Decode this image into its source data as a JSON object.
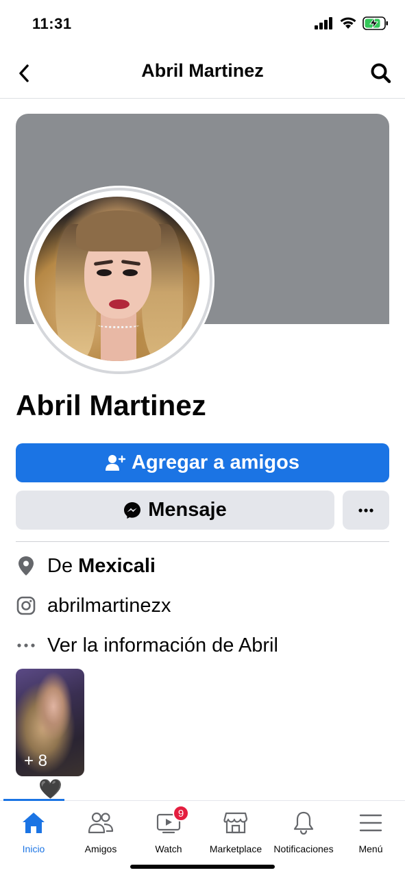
{
  "status_bar": {
    "time": "11:31",
    "icons": [
      "signal-icon",
      "wifi-icon",
      "battery-charging-icon"
    ],
    "battery_color": "#34c759"
  },
  "header": {
    "title": "Abril Martinez",
    "back_icon": "chevron-left-icon",
    "search_icon": "search-icon"
  },
  "profile": {
    "name": "Abril Martinez",
    "cover_color": "#8a8d91"
  },
  "actions": {
    "add_friend_label": "Agregar a amigos",
    "message_label": "Mensaje",
    "more_label": "•••",
    "accent": "#1b74e4"
  },
  "info": {
    "location_prefix": "De ",
    "location_city": "Mexicali",
    "instagram": "abrilmartinezx",
    "about_label": "Ver la información de Abril"
  },
  "featured": {
    "count_label": "+ 8",
    "emoji": "🖤"
  },
  "tabs": [
    {
      "label": "Inicio",
      "icon": "home-icon",
      "active": true
    },
    {
      "label": "Amigos",
      "icon": "friends-icon",
      "active": false
    },
    {
      "label": "Watch",
      "icon": "watch-icon",
      "active": false,
      "badge": "9"
    },
    {
      "label": "Marketplace",
      "icon": "marketplace-icon",
      "active": false
    },
    {
      "label": "Notificaciones",
      "icon": "bell-icon",
      "active": false
    },
    {
      "label": "Menú",
      "icon": "menu-icon",
      "active": false
    }
  ]
}
